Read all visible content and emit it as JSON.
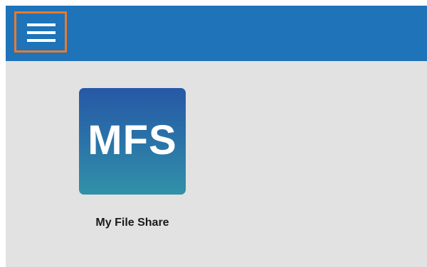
{
  "header": {
    "menu_icon": "hamburger-menu-icon",
    "background_color": "#1e73b9",
    "focus_outline_color": "#e87a2c"
  },
  "apps": [
    {
      "abbrev": "MFS",
      "label": "My File Share",
      "gradient_top": "#2758a6",
      "gradient_bottom": "#3291a8"
    }
  ]
}
